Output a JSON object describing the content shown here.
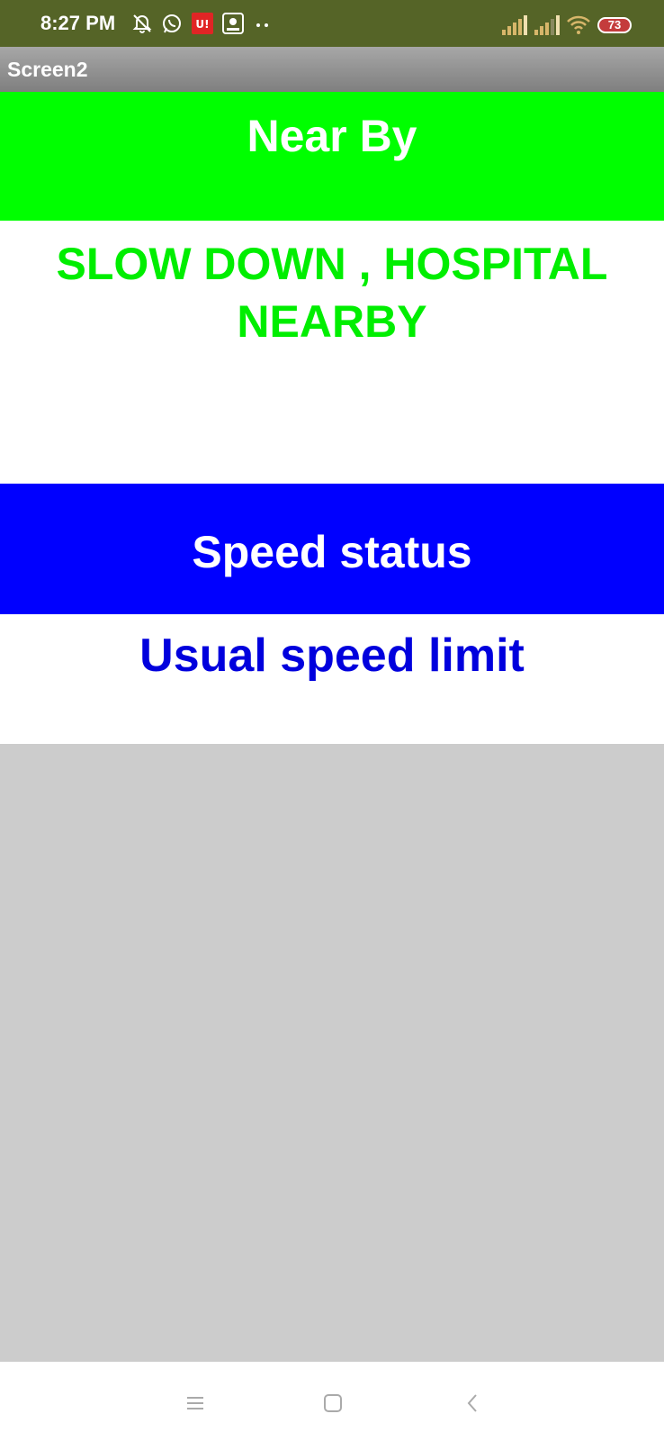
{
  "status_bar": {
    "time": "8:27 PM",
    "battery_level": "73",
    "left_icons": [
      "bell-off-icon",
      "whatsapp-icon",
      "app-notification-icon",
      "photo-app-icon",
      "more-dots-icon"
    ],
    "right_icons": [
      "signal-icon",
      "signal-icon",
      "wifi-icon",
      "battery-icon"
    ]
  },
  "title_bar": {
    "title": "Screen2"
  },
  "nearby_section": {
    "header": "Near By",
    "message": "SLOW DOWN , HOSPITAL NEARBY"
  },
  "speed_section": {
    "header": "Speed status",
    "value": "Usual speed limit"
  },
  "nav_bar": {
    "icons": [
      "menu-icon",
      "home-icon",
      "back-icon"
    ]
  },
  "colors": {
    "status_bar": "#556427",
    "nearby_header_bg": "#00ff00",
    "nearby_message_text": "#00ee00",
    "speed_header_bg": "#0000ff",
    "speed_value_text": "#0000dd",
    "empty_area_bg": "#cccccc"
  }
}
